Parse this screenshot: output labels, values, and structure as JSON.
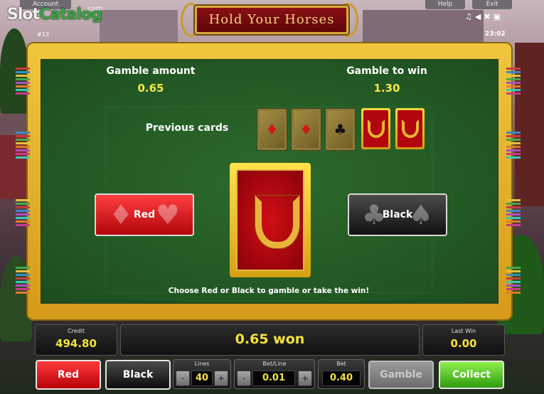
{
  "top_bar": {
    "account_label": "Account",
    "help_label": "Help",
    "exit_label": "Exit",
    "game_id": "#13",
    "clock": "23:02",
    "icons": [
      "music-icon",
      "speaker-icon",
      "close-icon",
      "fullscreen-icon"
    ]
  },
  "watermark": {
    "slot": "Slot",
    "catalog": "Catalog",
    "com": ".com"
  },
  "logo": {
    "title": "Hold Your Horses"
  },
  "gamble": {
    "amount_label": "Gamble amount",
    "amount_value": "0.65",
    "to_win_label": "Gamble to win",
    "to_win_value": "1.30",
    "previous_cards_label": "Previous cards",
    "previous_cards": [
      {
        "type": "wood",
        "suit": "diamond",
        "symbol": "♦",
        "color": "#d01818"
      },
      {
        "type": "wood",
        "suit": "diamond",
        "symbol": "♦",
        "color": "#d01818"
      },
      {
        "type": "wood",
        "suit": "club",
        "symbol": "♣",
        "color": "#111111"
      },
      {
        "type": "back",
        "suit": "horseshoe"
      },
      {
        "type": "back",
        "suit": "horseshoe"
      }
    ],
    "red_button_label": "Red",
    "black_button_label": "Black",
    "hint": "Choose Red or Black to gamble or take the win!"
  },
  "bottom": {
    "credit_label": "Credit",
    "credit_value": "494.80",
    "status_text": "0.65 won",
    "last_win_label": "Last Win",
    "last_win_value": "0.00",
    "lines_label": "Lines",
    "lines_value": "40",
    "bet_line_label": "Bet/Line",
    "bet_line_value": "0.01",
    "bet_label": "Bet",
    "bet_value": "0.40",
    "red_label": "Red",
    "black_label": "Black",
    "gamble_label": "Gamble",
    "collect_label": "Collect",
    "minus_symbol": "-",
    "plus_symbol": "+"
  },
  "colors": {
    "accent_gold": "#f0c63d",
    "felt_green": "#235a24",
    "value_yellow": "#f5e23c",
    "red": "#d0050f",
    "collect_green": "#4fc21c"
  }
}
